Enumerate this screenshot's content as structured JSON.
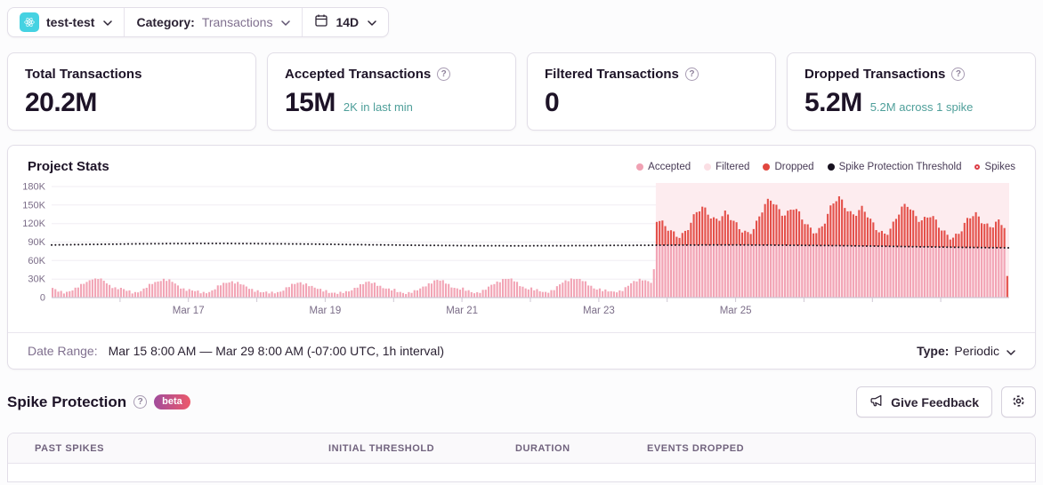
{
  "topbar": {
    "project_name": "test-test",
    "category_label": "Category:",
    "category_value": "Transactions",
    "date_range_label": "14D"
  },
  "cards": [
    {
      "title": "Total Transactions",
      "value": "20.2M",
      "sub": "",
      "help": false
    },
    {
      "title": "Accepted Transactions",
      "value": "15M",
      "sub": "2K in last min",
      "help": true
    },
    {
      "title": "Filtered Transactions",
      "value": "0",
      "sub": "",
      "help": true
    },
    {
      "title": "Dropped Transactions",
      "value": "5.2M",
      "sub": "5.2M across 1 spike",
      "help": true
    }
  ],
  "chart_panel": {
    "title": "Project Stats",
    "legend": [
      {
        "label": "Accepted",
        "color": "#f0a1b3",
        "type": "dot"
      },
      {
        "label": "Filtered",
        "color": "#fbdfe4",
        "type": "dot"
      },
      {
        "label": "Dropped",
        "color": "#e1473f",
        "type": "dot"
      },
      {
        "label": "Spike Protection Threshold",
        "color": "#17111f",
        "type": "dot"
      },
      {
        "label": "Spikes",
        "color": "#dc3e47",
        "type": "ring"
      }
    ]
  },
  "chart_data": {
    "type": "bar",
    "title": "Project Stats",
    "x_start": "Mar 15 8:00 AM",
    "x_end": "Mar 29 8:00 AM",
    "interval": "1h",
    "num_bars": 336,
    "x_tick_labels": [
      "Mar 17",
      "Mar 19",
      "Mar 21",
      "Mar 23",
      "Mar 25"
    ],
    "x_tick_hours": [
      48,
      96,
      144,
      192,
      240
    ],
    "ylim": [
      0,
      180000
    ],
    "y_tick_values_k": [
      180,
      150,
      120,
      90,
      60,
      30,
      0
    ],
    "y_tick_labels": [
      "180K",
      "150K",
      "120K",
      "90K",
      "60K",
      "30K",
      "0"
    ],
    "grid": true,
    "legend_position": "top-right",
    "series": [
      {
        "name": "Accepted",
        "color": "#f2a4b5",
        "unit": "K",
        "baseline_daily_pattern_k": [
          13,
          11,
          10,
          9,
          8,
          8,
          9,
          10,
          12,
          15,
          18,
          21,
          23,
          25,
          27,
          28,
          27,
          26,
          24,
          21,
          18,
          16,
          14,
          13
        ],
        "baseline_range_k": [
          8,
          31
        ],
        "during_spike": "capped at spike protection threshold (~84K-88K)"
      },
      {
        "name": "Filtered",
        "color": "#fbdfe4",
        "values": 0
      },
      {
        "name": "Dropped",
        "color": "#e4504a",
        "unit": "K",
        "above_threshold_daily_pattern_k": [
          30,
          26,
          23,
          21,
          20,
          22,
          26,
          32,
          40,
          48,
          55,
          60,
          63,
          60,
          55,
          50,
          46,
          44,
          45,
          48,
          50,
          46,
          40,
          34
        ],
        "above_threshold_range_k": [
          10,
          80
        ],
        "total": "5.2M"
      }
    ],
    "threshold": {
      "name": "Spike Protection Threshold",
      "color": "#1b161f",
      "style": "dotted",
      "base_k": 84,
      "wave_amplitude_k": 3
    },
    "spike": {
      "count": 1,
      "start_hour": 212,
      "end_hour": 336,
      "region_color": "#fdecef",
      "events_dropped": "5.2M"
    },
    "last_bar": {
      "hour": 335,
      "dropped_k": 35,
      "note": "short partial-hour red bar at right edge"
    }
  },
  "date_footer": {
    "label": "Date Range:",
    "value": "Mar 15 8:00 AM — Mar 29 8:00 AM (-07:00 UTC, 1h interval)",
    "type_label": "Type:",
    "type_value": "Periodic"
  },
  "spike_section": {
    "title": "Spike Protection",
    "badge": "beta",
    "feedback_button": "Give Feedback"
  },
  "table": {
    "columns": [
      "PAST SPIKES",
      "INITIAL THRESHOLD",
      "DURATION",
      "EVENTS DROPPED"
    ]
  }
}
